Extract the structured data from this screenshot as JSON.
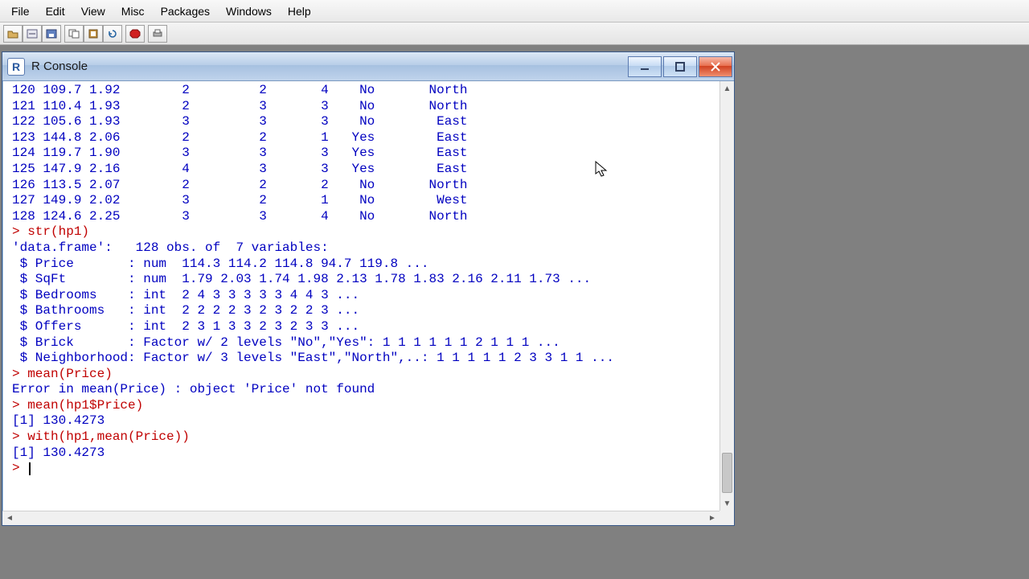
{
  "menu": [
    "File",
    "Edit",
    "View",
    "Misc",
    "Packages",
    "Windows",
    "Help"
  ],
  "toolbar_icons": [
    "open-icon",
    "load-workspace-icon",
    "save-icon",
    "copy-icon",
    "paste-icon",
    "refresh-icon",
    "stop-icon",
    "print-icon"
  ],
  "window": {
    "title": "R Console"
  },
  "console": {
    "data_rows": [
      {
        "n": "120",
        "v1": "109.7",
        "v2": "1.92",
        "b": "2",
        "c": "2",
        "d": "4",
        "e": "No",
        "f": "North"
      },
      {
        "n": "121",
        "v1": "110.4",
        "v2": "1.93",
        "b": "2",
        "c": "3",
        "d": "3",
        "e": "No",
        "f": "North"
      },
      {
        "n": "122",
        "v1": "105.6",
        "v2": "1.93",
        "b": "3",
        "c": "3",
        "d": "3",
        "e": "No",
        "f": "East"
      },
      {
        "n": "123",
        "v1": "144.8",
        "v2": "2.06",
        "b": "2",
        "c": "2",
        "d": "1",
        "e": "Yes",
        "f": "East"
      },
      {
        "n": "124",
        "v1": "119.7",
        "v2": "1.90",
        "b": "3",
        "c": "3",
        "d": "3",
        "e": "Yes",
        "f": "East"
      },
      {
        "n": "125",
        "v1": "147.9",
        "v2": "2.16",
        "b": "4",
        "c": "3",
        "d": "3",
        "e": "Yes",
        "f": "East"
      },
      {
        "n": "126",
        "v1": "113.5",
        "v2": "2.07",
        "b": "2",
        "c": "2",
        "d": "2",
        "e": "No",
        "f": "North"
      },
      {
        "n": "127",
        "v1": "149.9",
        "v2": "2.02",
        "b": "3",
        "c": "2",
        "d": "1",
        "e": "No",
        "f": "West"
      },
      {
        "n": "128",
        "v1": "124.6",
        "v2": "2.25",
        "b": "3",
        "c": "3",
        "d": "4",
        "e": "No",
        "f": "North"
      }
    ],
    "cmd1": "> str(hp1)",
    "str_out": [
      "'data.frame':   128 obs. of  7 variables:",
      " $ Price       : num  114.3 114.2 114.8 94.7 119.8 ...",
      " $ SqFt        : num  1.79 2.03 1.74 1.98 2.13 1.78 1.83 2.16 2.11 1.73 ...",
      " $ Bedrooms    : int  2 4 3 3 3 3 3 4 4 3 ...",
      " $ Bathrooms   : int  2 2 2 2 3 2 3 2 2 3 ...",
      " $ Offers      : int  2 3 1 3 3 2 3 2 3 3 ...",
      " $ Brick       : Factor w/ 2 levels \"No\",\"Yes\": 1 1 1 1 1 1 2 1 1 1 ...",
      " $ Neighborhood: Factor w/ 3 levels \"East\",\"North\",..: 1 1 1 1 1 2 3 3 1 1 ..."
    ],
    "cmd2": "> mean(Price)",
    "err": "Error in mean(Price) : object 'Price' not found",
    "cmd3": "> mean(hp1$Price)",
    "out3": "[1] 130.4273",
    "cmd4": "> with(hp1,mean(Price))",
    "out4": "[1] 130.4273",
    "prompt": "> "
  }
}
